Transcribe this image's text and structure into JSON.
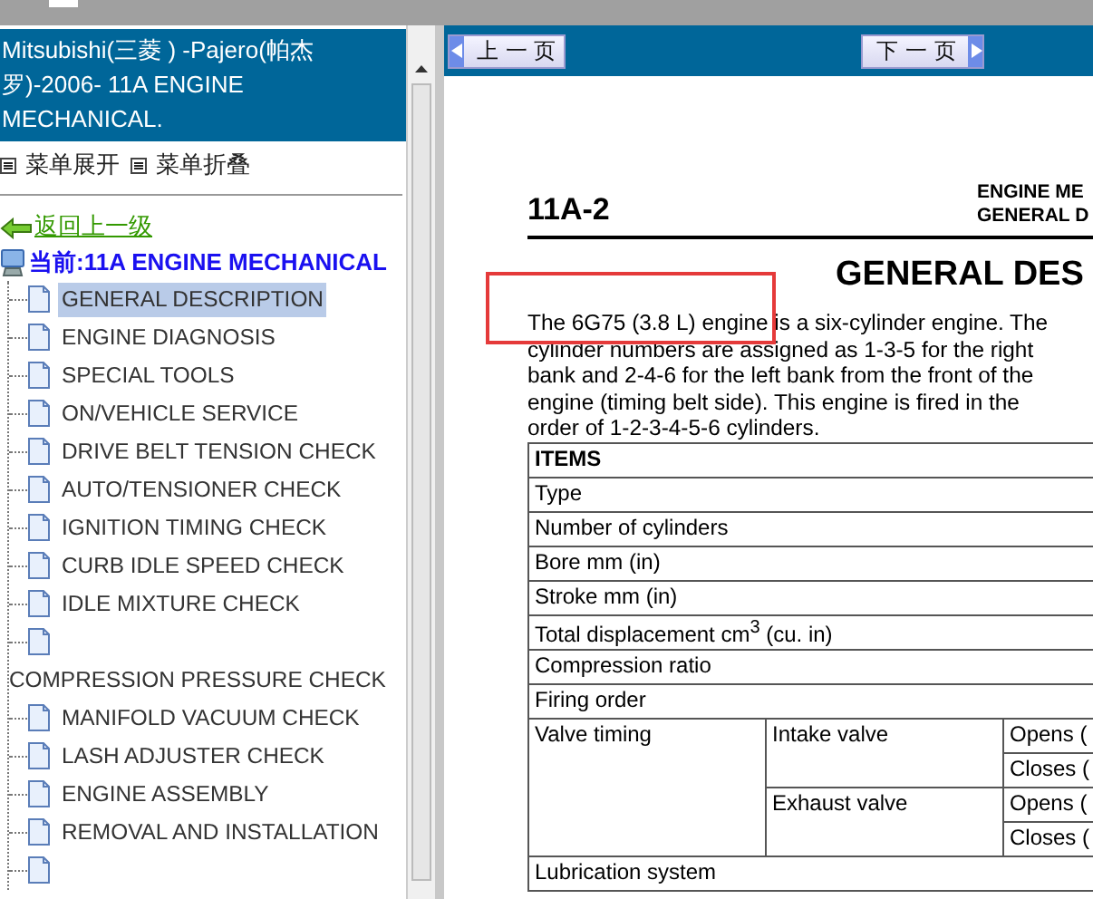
{
  "sidebar": {
    "title": "Mitsubishi(三菱 ) -Pajero(帕杰罗)-2006- 11A ENGINE MECHANICAL.",
    "menu_actions": [
      {
        "label": "菜单展开"
      },
      {
        "label": "菜单折叠"
      }
    ],
    "back_link": "返回上一级",
    "current": {
      "label": "当前:11A ENGINE MECHANICAL",
      "children": [
        {
          "kind": "entry",
          "label": "GENERAL DESCRIPTION",
          "selected": true
        },
        {
          "kind": "entry",
          "label": "ENGINE DIAGNOSIS",
          "selected": false
        },
        {
          "kind": "entry",
          "label": "SPECIAL TOOLS",
          "selected": false
        },
        {
          "kind": "entry",
          "label": "ON/VEHICLE SERVICE",
          "selected": false
        },
        {
          "kind": "entry",
          "label": "DRIVE BELT TENSION CHECK",
          "selected": false
        },
        {
          "kind": "entry",
          "label": "AUTO/TENSIONER CHECK",
          "selected": false
        },
        {
          "kind": "entry",
          "label": "IGNITION TIMING CHECK",
          "selected": false
        },
        {
          "kind": "entry",
          "label": "CURB IDLE SPEED CHECK",
          "selected": false
        },
        {
          "kind": "entry",
          "label": "IDLE MIXTURE CHECK",
          "selected": false
        },
        {
          "kind": "entry",
          "label": "COMPRESSION PRESSURE CHECK",
          "selected": false
        },
        {
          "kind": "entry",
          "label": "MANIFOLD VACUUM CHECK",
          "selected": false
        },
        {
          "kind": "entry",
          "label": "LASH ADJUSTER CHECK",
          "selected": false
        },
        {
          "kind": "entry",
          "label": "ENGINE ASSEMBLY",
          "selected": false
        },
        {
          "kind": "entry",
          "label": "REMOVAL AND INSTALLATION",
          "selected": false
        },
        {
          "kind": "icon_only"
        }
      ]
    }
  },
  "nav": {
    "prev": "上 一 页",
    "next": "下 一 页"
  },
  "document": {
    "page_number": "11A-2",
    "header_right": [
      "ENGINE ME",
      "GENERAL D"
    ],
    "heading": "GENERAL DES",
    "intro": "The 6G75 (3.8 L) engine is a six-cylinder engine. The cylinder numbers are assigned as 1-3-5 for the right bank and 2-4-6 for the left bank from the front of the engine (timing belt side). This engine is fired in the order of 1-2-3-4-5-6 cylinders.",
    "annotation_box": {
      "shown": true
    },
    "table": {
      "rows": [
        {
          "kind": "header",
          "label": "ITEMS"
        },
        {
          "kind": "plain",
          "label": "Type"
        },
        {
          "kind": "plain",
          "label": "Number of cylinders"
        },
        {
          "kind": "plain",
          "label": "Bore mm (in)"
        },
        {
          "kind": "plain",
          "label": "Stroke mm (in)"
        },
        {
          "kind": "plain",
          "label": "Total displacement cm$^{3}$ (cu. in)"
        },
        {
          "kind": "plain",
          "label": "Compression ratio"
        },
        {
          "kind": "plain",
          "label": "Firing order"
        },
        {
          "kind": "group",
          "label": "Valve timing",
          "groups": [
            {
              "label": "Intake valve",
              "items": [
                "Opens (",
                "Closes ("
              ]
            },
            {
              "label": "Exhaust valve",
              "items": [
                "Opens (",
                "Closes ("
              ]
            }
          ]
        },
        {
          "kind": "plain",
          "label": "Lubrication system"
        }
      ]
    }
  }
}
